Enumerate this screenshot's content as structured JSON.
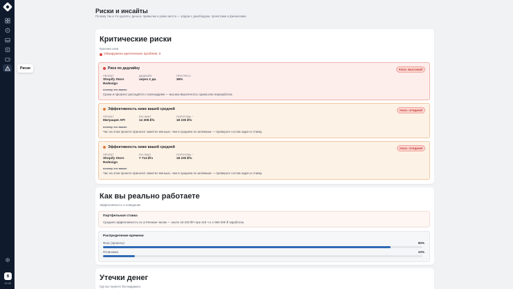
{
  "sidebar": {
    "items": [
      {
        "name": "grid-icon"
      },
      {
        "name": "palette-icon"
      },
      {
        "name": "inbox-icon"
      },
      {
        "name": "book-icon"
      },
      {
        "name": "wallet-icon"
      },
      {
        "name": "warning-icon",
        "active": true
      }
    ],
    "tooltip": "Риски",
    "user_initial": "B",
    "time": "19:46"
  },
  "header": {
    "title": "Риски и инсайты",
    "subtitle": "Почему так и что делать: деньги, привычки и узкие места — рядом с дашбордом, проектами и финансами."
  },
  "critical": {
    "title": "Критические риски",
    "subtitle": "Красная зона",
    "alert": "Обнаружено критических проблем: 3",
    "labels": {
      "project": "ПРОЕКТ",
      "deadline": "ДЕДЛАЙН",
      "progress": "ПРОГРЕСС",
      "rate_fact": "R/Ч ФАКТ",
      "threshold": "ПОРОГОВЬ ~",
      "why": "почему это важно"
    },
    "items": [
      {
        "title": "Риск по дедлайну",
        "badge": "РИСК: ВЫСОКИЙ",
        "project": "Shopify Store Redesign",
        "deadline": "через 2 дн.",
        "progress": "36%",
        "why": "Сроки и прогресс расходятся с календарём — высока вероятность срыва или переработок."
      },
      {
        "title": "Эффективность ниже вашей средней",
        "badge": "РИСК: СРЕДНИЙ",
        "project": "Миграция API",
        "rate": "14 308 ₽/ч",
        "threshold": "18 230 ₽/ч",
        "why": "Час на этом проекте приносит заметно меньше, чем в среднем по активным — проверьте состав задач и ставку."
      },
      {
        "title": "Эффективность ниже вашей средней",
        "badge": "РИСК: СРЕДНИЙ",
        "project": "Shopify Store Redesign",
        "rate": "7 714 ₽/ч",
        "threshold": "18 230 ₽/ч",
        "why": "Час на этом проекте приносит заметно меньше, чем в среднем по активным — проверьте состав задач и ставку."
      }
    ]
  },
  "work": {
    "title": "Как вы реально работаете",
    "subtitle": "Эффективность и поведение",
    "portfolio": {
      "title": "Портфельная ставка",
      "text": "Средняя эффективность по учтённым часам — около 18 230 ₽/ч при 119 ч и 1 666 000 ₽ заработка."
    },
    "distribution": {
      "title": "Распределение времени",
      "rows": [
        {
          "label": "Фокс (проекты)",
          "pct": "90%",
          "value": 0.9
        },
        {
          "label": "Починовка",
          "pct": "10%",
          "value": 0.1
        }
      ]
    }
  },
  "leaks": {
    "title": "Утечки денег",
    "subtitle": "Где вы теряете без видимого"
  },
  "colors": {
    "accent": "#2f6ab5",
    "danger": "#d9413a",
    "warning": "#e07a3a",
    "sidebar": "#0f1b2d"
  }
}
